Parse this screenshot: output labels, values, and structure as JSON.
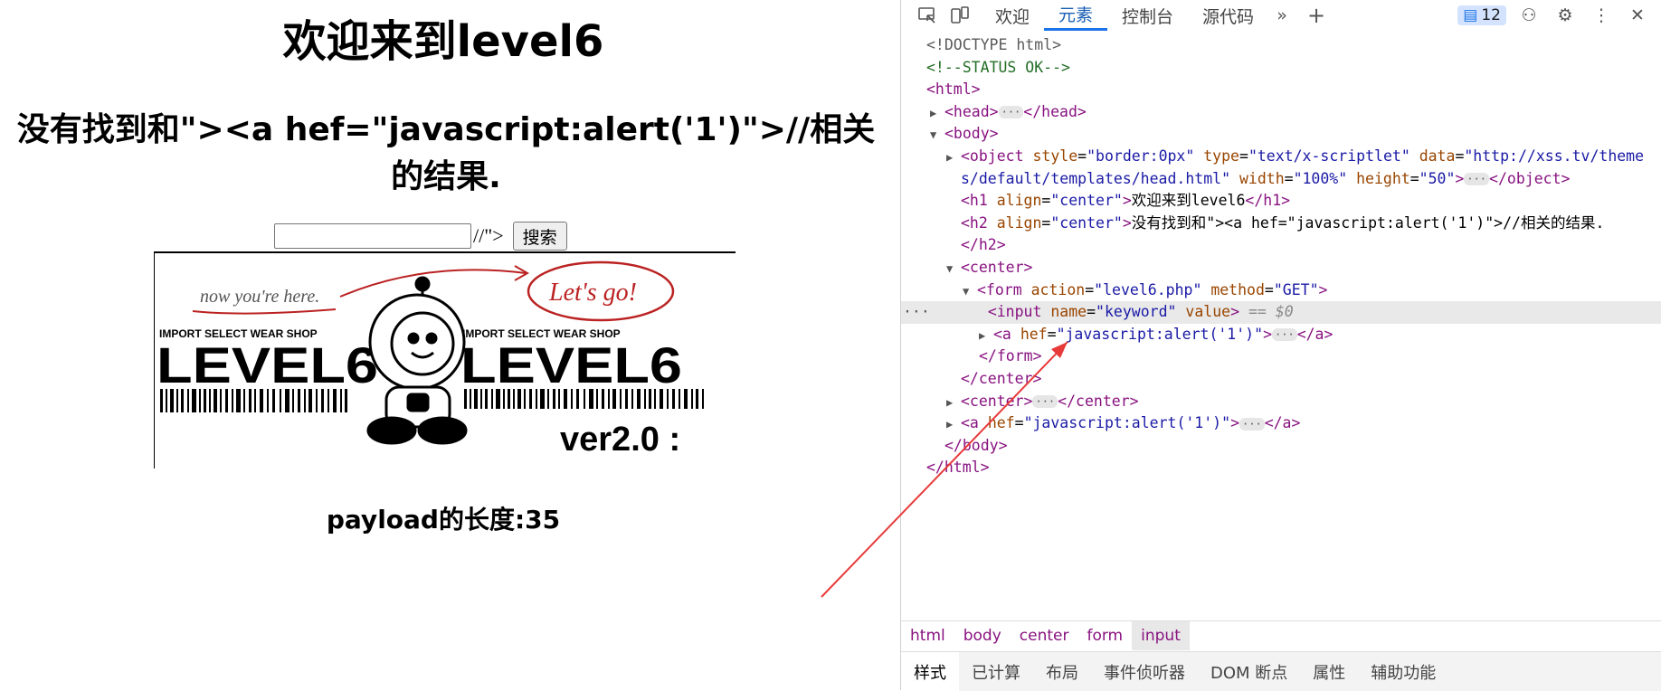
{
  "page": {
    "h1": "欢迎来到level6",
    "h2": "没有找到和\"><a hef=\"javascript:alert('1')\">//相关的结果.",
    "input_value": "",
    "after_input_text": "//\">",
    "search_button": "搜索",
    "payload_text": "payload的长度:35",
    "banner": {
      "tagline_left": "now you're here.",
      "tagline_right": "Let's go!",
      "shop_left": "IMPORT SELECT WEAR SHOP",
      "shop_right": "IMPORT SELECT WEAR SHOP",
      "logo_left": "LEVEL6",
      "logo_right": "LEVEL6",
      "version": "ver2.0 :"
    }
  },
  "devtools": {
    "tabs": [
      "欢迎",
      "元素",
      "控制台",
      "源代码"
    ],
    "active_tab": "元素",
    "issues_count": "12",
    "breadcrumbs": [
      "html",
      "body",
      "center",
      "form",
      "input"
    ],
    "active_breadcrumb": "input",
    "subtabs": [
      "样式",
      "已计算",
      "布局",
      "事件侦听器",
      "DOM 断点",
      "属性",
      "辅助功能"
    ],
    "active_subtab": "样式",
    "dom": {
      "doctype": "<!DOCTYPE html>",
      "comment": "<!--STATUS OK-->",
      "object_url": "http://xss.tv/themes/default/templates/head.html",
      "h1_text": "欢迎来到level6",
      "h2_text": "没有找到和\"><a hef=\"javascript:alert('1')\">//相关的结果.",
      "form_action": "level6.php",
      "form_method": "GET",
      "input_name": "keyword",
      "anchor_hef": "javascript:alert('1')",
      "selected_marker": "== $0"
    }
  },
  "colors": {
    "tag": "#881280",
    "attr": "#994500",
    "value": "#1a1aa6",
    "accent": "#1a73e8",
    "arrow": "#e83a3a"
  }
}
